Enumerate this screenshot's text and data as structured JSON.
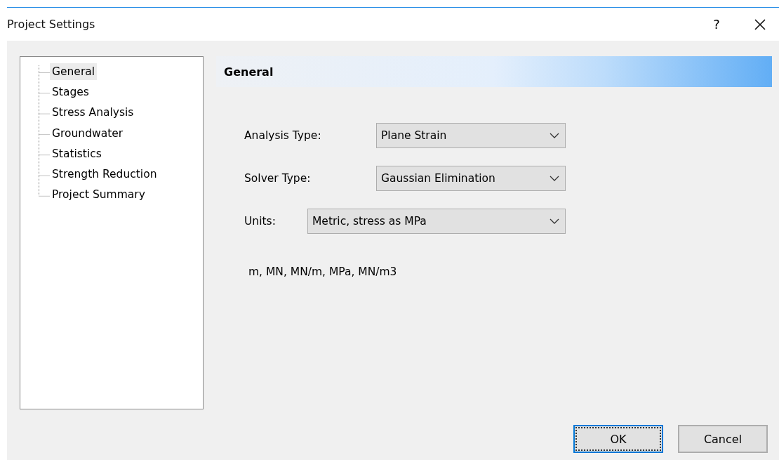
{
  "window": {
    "title": "Project Settings",
    "help": "?"
  },
  "tree": {
    "items": [
      {
        "label": "General",
        "selected": true
      },
      {
        "label": "Stages",
        "selected": false
      },
      {
        "label": "Stress Analysis",
        "selected": false
      },
      {
        "label": "Groundwater",
        "selected": false
      },
      {
        "label": "Statistics",
        "selected": false
      },
      {
        "label": "Strength Reduction",
        "selected": false
      },
      {
        "label": "Project Summary",
        "selected": false
      }
    ]
  },
  "panel": {
    "heading": "General",
    "fields": [
      {
        "label": "Analysis Type:",
        "value": "Plane Strain",
        "kind": "short"
      },
      {
        "label": "Solver Type:",
        "value": "Gaussian Elimination",
        "kind": "short"
      },
      {
        "label": "Units:",
        "value": "Metric, stress as MPa",
        "kind": "wide"
      }
    ],
    "units_note": "m, MN, MN/m, MPa, MN/m3"
  },
  "buttons": [
    {
      "label": "OK",
      "focused": true
    },
    {
      "label": "Cancel",
      "focused": false
    }
  ]
}
